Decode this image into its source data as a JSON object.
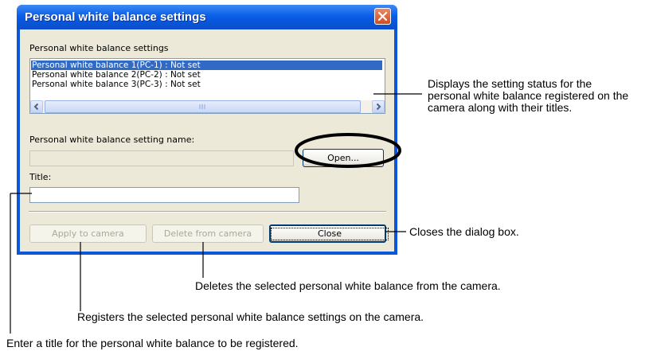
{
  "dialog": {
    "title": "Personal white balance settings",
    "list_label": "Personal white balance settings",
    "list_items": [
      "Personal white balance 1(PC-1) : Not set",
      "Personal white balance 2(PC-2) : Not set",
      "Personal white balance 3(PC-3) : Not set"
    ],
    "setting_name_label": "Personal white balance setting name:",
    "setting_name_value": "",
    "open_button": "Open...",
    "title_label": "Title:",
    "title_value": "",
    "apply_button": "Apply to camera",
    "delete_button": "Delete from camera",
    "close_button": "Close"
  },
  "annotations": {
    "list": "Displays the setting status for the personal white balance registered on the camera along with their titles.",
    "close": "Closes the dialog box.",
    "delete": "Deletes the selected personal white balance from the camera.",
    "apply": "Registers the selected personal white balance settings on the camera.",
    "title": "Enter a title for the personal white balance to be registered."
  }
}
